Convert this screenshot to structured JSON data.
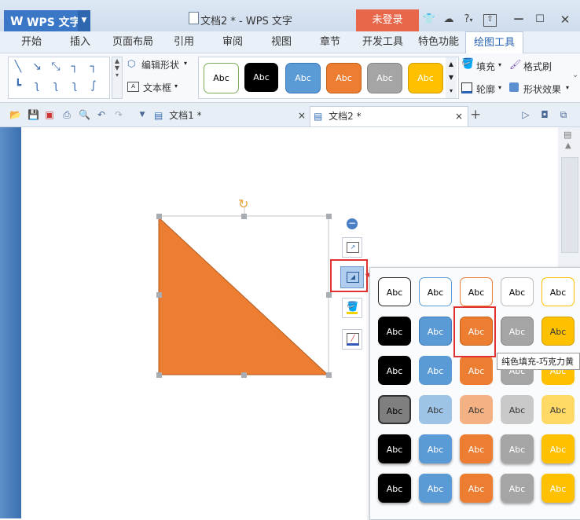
{
  "titlebar": {
    "app_name": "WPS 文字",
    "doc_title": "文档2 * - WPS 文字",
    "login_label": "未登录",
    "help_label": "?"
  },
  "menu_tabs": [
    "开始",
    "插入",
    "页面布局",
    "引用",
    "审阅",
    "视图",
    "章节",
    "开发工具",
    "特色功能",
    "绘图工具"
  ],
  "active_tab": "绘图工具",
  "ribbon": {
    "edit_shape": "编辑形状",
    "textbox": "文本框",
    "fill": "填充",
    "format_painter": "格式刷",
    "outline": "轮廓",
    "shape_effects": "形状效果",
    "style_label": "Abc",
    "style_colors": [
      "#ffffff",
      "#000000",
      "#5b9bd5",
      "#ed7d31",
      "#a5a5a5",
      "#ffc000"
    ]
  },
  "doc_tabs": [
    {
      "label": "文档1 *",
      "close": "×"
    },
    {
      "label": "文档2 *",
      "close": "×"
    }
  ],
  "new_tab": "+",
  "shape": {
    "fill_color": "#ed7d31",
    "outline_color": "#b25a1d"
  },
  "palette": {
    "cell_label": "Abc",
    "tooltip": "纯色填充-巧克力黄",
    "highlight_color": "#e03232"
  }
}
